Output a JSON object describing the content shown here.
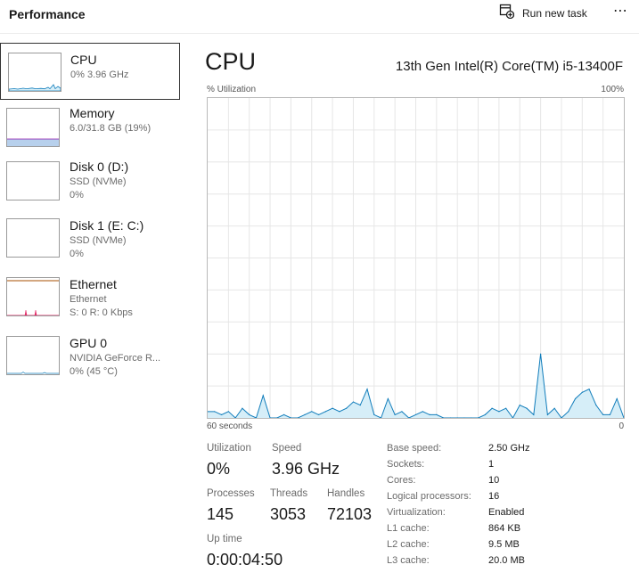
{
  "header": {
    "title": "Performance",
    "run_new_task": "Run new task",
    "more_label": "⋯"
  },
  "sidebar": {
    "items": [
      {
        "name": "CPU",
        "line1": "0% 3.96 GHz",
        "line2": ""
      },
      {
        "name": "Memory",
        "line1": "6.0/31.8 GB (19%)",
        "line2": ""
      },
      {
        "name": "Disk 0 (D:)",
        "line1": "SSD (NVMe)",
        "line2": "0%"
      },
      {
        "name": "Disk 1 (E: C:)",
        "line1": "SSD (NVMe)",
        "line2": "0%"
      },
      {
        "name": "Ethernet",
        "line1": "Ethernet",
        "line2": "S: 0 R: 0 Kbps"
      },
      {
        "name": "GPU 0",
        "line1": "NVIDIA GeForce R...",
        "line2": "0% (45 °C)"
      }
    ]
  },
  "main": {
    "title": "CPU",
    "model": "13th Gen Intel(R) Core(TM) i5-13400F",
    "axis": {
      "top_left": "% Utilization",
      "top_right": "100%",
      "bottom_left": "60 seconds",
      "bottom_right": "0"
    },
    "stats": {
      "utilization_label": "Utilization",
      "utilization_value": "0%",
      "speed_label": "Speed",
      "speed_value": "3.96 GHz",
      "processes_label": "Processes",
      "processes_value": "145",
      "threads_label": "Threads",
      "threads_value": "3053",
      "handles_label": "Handles",
      "handles_value": "72103",
      "uptime_label": "Up time",
      "uptime_value": "0:00:04:50"
    },
    "specs": [
      {
        "label": "Base speed:",
        "value": "2.50 GHz"
      },
      {
        "label": "Sockets:",
        "value": "1"
      },
      {
        "label": "Cores:",
        "value": "10"
      },
      {
        "label": "Logical processors:",
        "value": "16"
      },
      {
        "label": "Virtualization:",
        "value": "Enabled"
      },
      {
        "label": "L1 cache:",
        "value": "864 KB"
      },
      {
        "label": "L2 cache:",
        "value": "9.5 MB"
      },
      {
        "label": "L3 cache:",
        "value": "20.0 MB"
      }
    ]
  },
  "colors": {
    "cpu_line": "#117dbb",
    "cpu_fill": "#d6eef8",
    "memory_line": "#8b12ae",
    "memory_fill": "#b7d0ec",
    "ethernet_line": "#a74f01",
    "ethernet_spike": "#e32f6a",
    "grid": "#e6e6e6"
  },
  "chart_data": {
    "type": "area",
    "x": [
      60,
      59,
      58,
      57,
      56,
      55,
      54,
      53,
      52,
      51,
      50,
      49,
      48,
      47,
      46,
      45,
      44,
      43,
      42,
      41,
      40,
      39,
      38,
      37,
      36,
      35,
      34,
      33,
      32,
      31,
      30,
      29,
      28,
      27,
      26,
      25,
      24,
      23,
      22,
      21,
      20,
      19,
      18,
      17,
      16,
      15,
      14,
      13,
      12,
      11,
      10,
      9,
      8,
      7,
      6,
      5,
      4,
      3,
      2,
      1,
      0
    ],
    "series": [
      {
        "values": [
          2,
          2,
          1,
          2,
          0,
          3,
          1,
          0,
          7,
          0,
          0,
          1,
          0,
          0,
          1,
          2,
          1,
          2,
          3,
          2,
          3,
          5,
          4,
          9,
          1,
          0,
          6,
          1,
          2,
          0,
          1,
          2,
          1,
          1,
          0,
          0,
          0,
          0,
          0,
          0,
          1,
          3,
          2,
          3,
          0,
          4,
          3,
          1,
          20,
          1,
          3,
          0,
          2,
          6,
          8,
          9,
          4,
          1,
          1,
          6,
          0
        ]
      }
    ],
    "xlabel": "60 seconds",
    "ylabel": "% Utilization",
    "xlim": [
      60,
      0
    ],
    "ylim": [
      0,
      100
    ],
    "grid": true
  }
}
